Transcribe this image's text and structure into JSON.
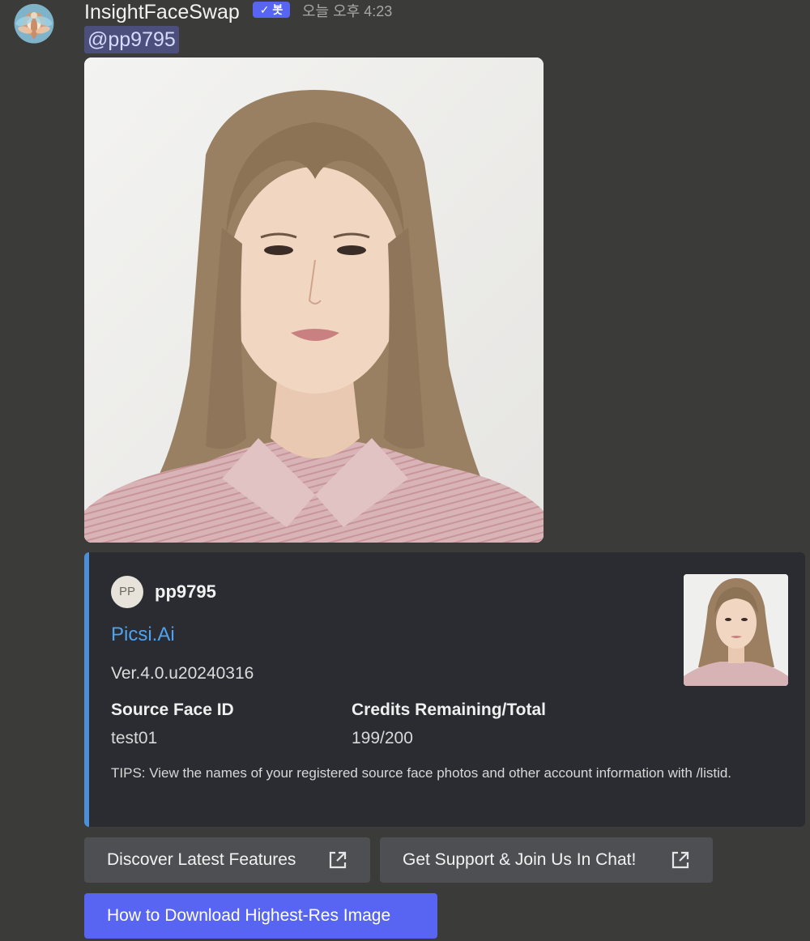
{
  "message": {
    "author": "InsightFaceSwap",
    "bot_badge": "✓ 봇",
    "timestamp": "오늘 오후 4:23",
    "mention": "@pp9795"
  },
  "embed": {
    "author_icon_text": "PP",
    "author_name": "pp9795",
    "title": "Picsi.Ai",
    "description": "Ver.4.0.u20240316",
    "fields": [
      {
        "name": "Source Face ID",
        "value": "test01"
      },
      {
        "name": "Credits Remaining/Total",
        "value": "199/200"
      }
    ],
    "tips": "TIPS: View the names of your registered source face photos and other account information with /listid."
  },
  "buttons": {
    "discover": "Discover Latest Features",
    "support": "Get Support & Join Us In Chat!",
    "download": "How to Download Highest-Res Image"
  },
  "colors": {
    "background": "#3b3b39",
    "embed_bg": "#2b2c31",
    "embed_accent": "#4b8fd6",
    "link": "#4ea3f1",
    "blurple": "#5865f2"
  },
  "icons": {
    "external_link": "external-link-icon",
    "bot_check": "check-icon"
  }
}
